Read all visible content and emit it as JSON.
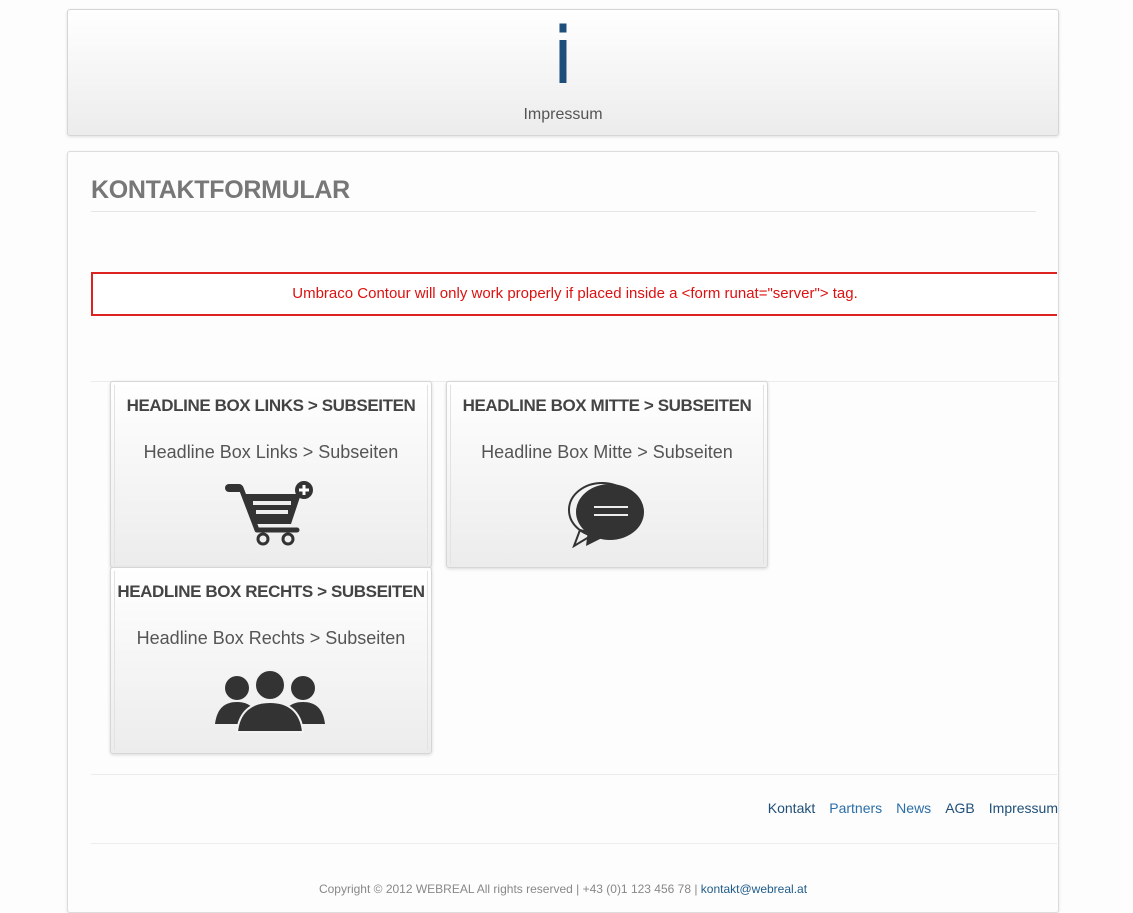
{
  "header": {
    "icon_glyph": "i",
    "label": "Impressum"
  },
  "page_title": "KONTAKTFORMULAR",
  "error_message": "Umbraco Contour will only work properly if placed inside a <form runat=\"server\"> tag.",
  "boxes": [
    {
      "headline": "HEADLINE BOX LINKS > SUBSEITEN",
      "subline": "Headline Box Links > Subseiten",
      "icon": "shopping-cart-add-icon"
    },
    {
      "headline": "HEADLINE BOX MITTE > SUBSEITEN",
      "subline": "Headline Box Mitte > Subseiten",
      "icon": "speech-bubble-icon"
    },
    {
      "headline": "HEADLINE BOX RECHTS > SUBSEITEN",
      "subline": "Headline Box Rechts > Subseiten",
      "icon": "user-group-icon"
    }
  ],
  "footer_nav": [
    {
      "label": "Kontakt",
      "color": "#1f4f78"
    },
    {
      "label": "Partners",
      "color": "#2a6ea8"
    },
    {
      "label": "News",
      "color": "#2a6ea8"
    },
    {
      "label": "AGB",
      "color": "#1f4f78"
    },
    {
      "label": "Impressum",
      "color": "#1f4f78"
    }
  ],
  "copyright": {
    "text": "Copyright © 2012 WEBREAL All rights reserved | +43 (0)1 123 456 78 | ",
    "email": "kontakt@webreal.at"
  },
  "colors": {
    "accent": "#1f4f78",
    "error": "#dd1111"
  }
}
